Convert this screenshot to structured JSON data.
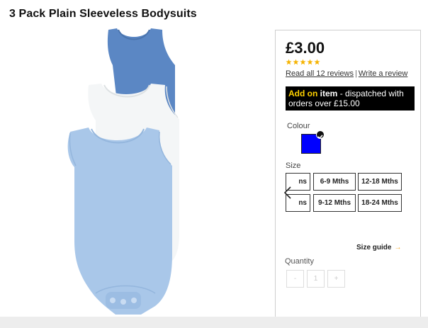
{
  "product": {
    "title": "3 Pack Plain Sleeveless Bodysuits",
    "image_icon": "bodysuit-image"
  },
  "purchase": {
    "price": "£3.00",
    "rating": {
      "stars": 5,
      "color": "#f5b301"
    },
    "read_reviews": "Read all 12 reviews",
    "separator": "|",
    "write_review": "Write a review",
    "addon": {
      "prefix": "Add on",
      "item": "item",
      "rest": " - dispatched with orders over £15.00",
      "prefix_color": "#ffd200"
    },
    "colour": {
      "label": "Colour",
      "selected": "#0000ff"
    },
    "size": {
      "label": "Size",
      "options": [
        [
          "ns",
          "6-9 Mths",
          "12-18 Mths"
        ],
        [
          "ns",
          "9-12 Mths",
          "18-24 Mths"
        ]
      ],
      "size_guide": "Size guide",
      "size_guide_arrow": "→",
      "prev_icon": "chevron-left-icon"
    },
    "quantity": {
      "label": "Quantity",
      "minus": "-",
      "value": "1",
      "plus": "+"
    }
  }
}
